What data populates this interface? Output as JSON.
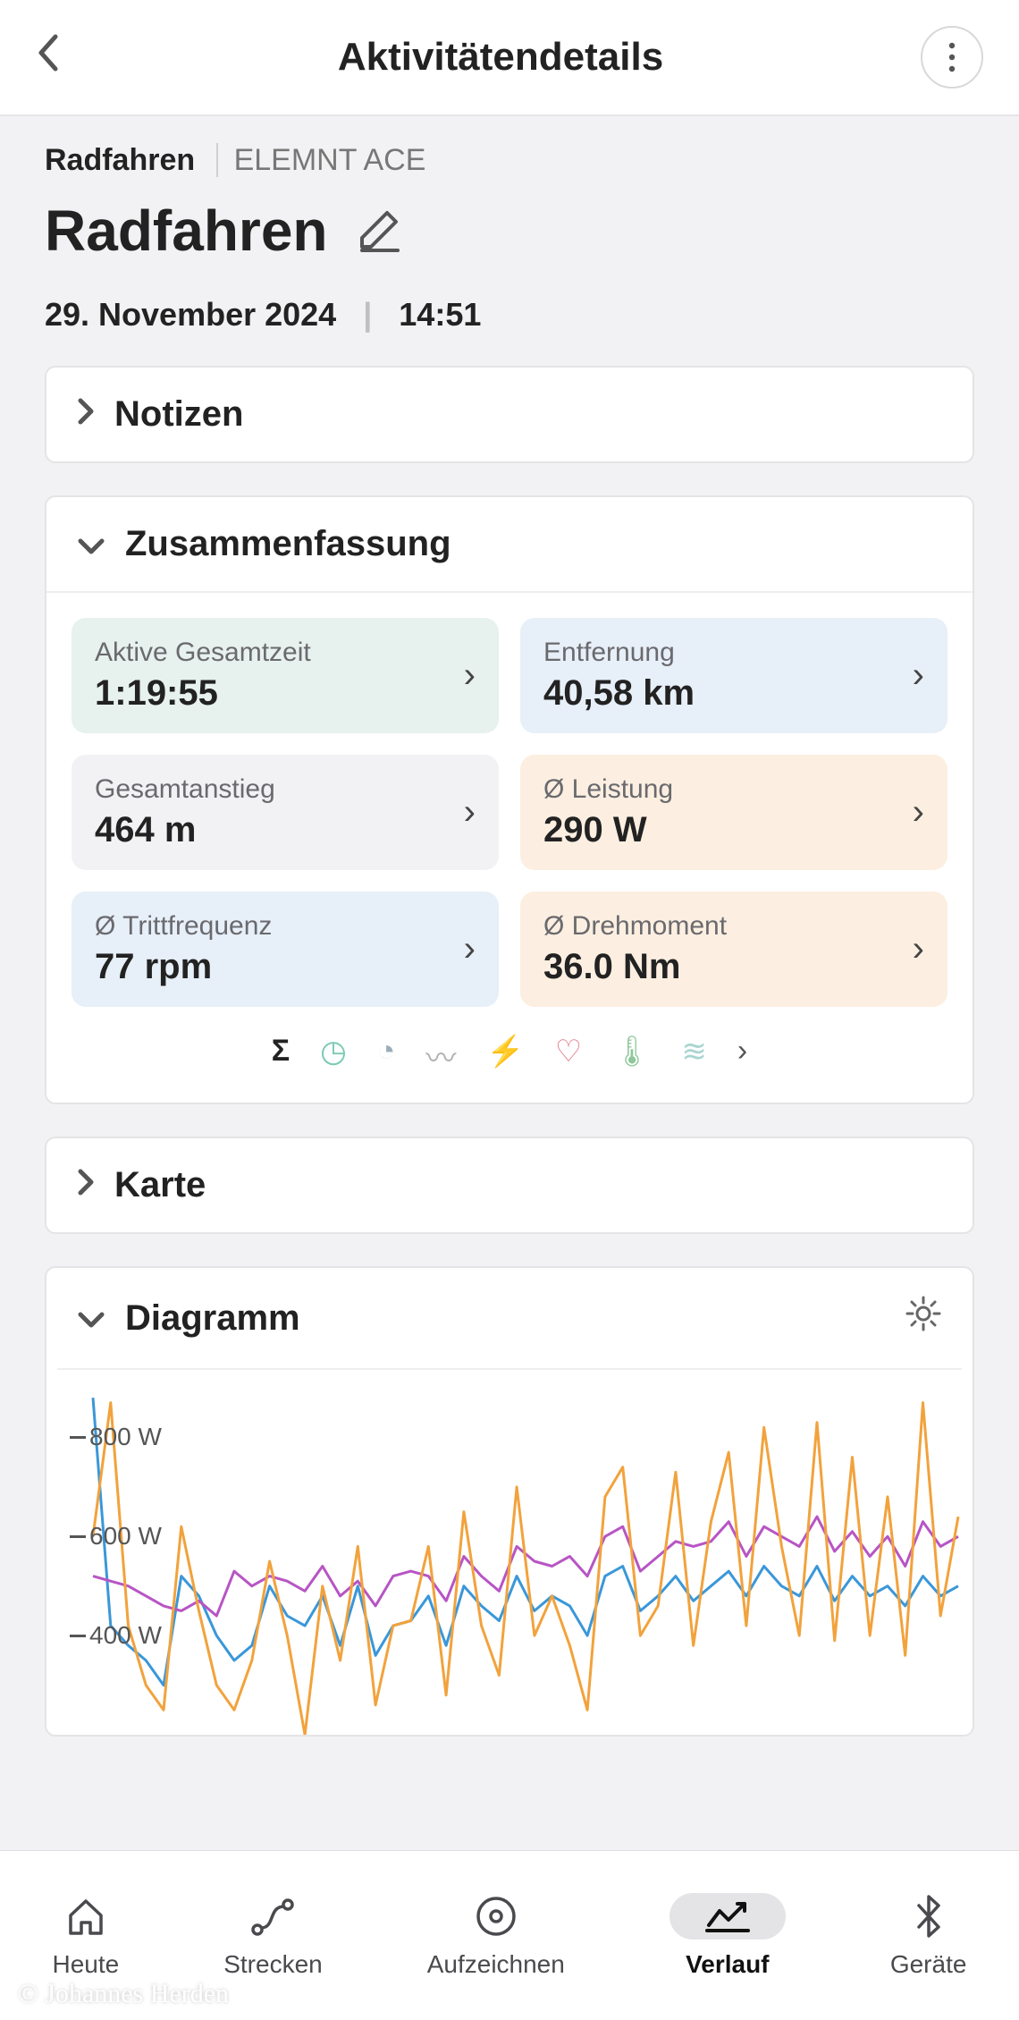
{
  "header": {
    "title": "Aktivitätendetails"
  },
  "breadcrumb": {
    "category": "Radfahren",
    "device": "ELEMNT ACE"
  },
  "activity": {
    "name": "Radfahren",
    "date": "29. November 2024",
    "time": "14:51"
  },
  "sections": {
    "notes": "Notizen",
    "summary": "Zusammenfassung",
    "map": "Karte",
    "chart": "Diagramm"
  },
  "tiles": {
    "active_time": {
      "label": "Aktive Gesamtzeit",
      "value": "1:19:55"
    },
    "distance": {
      "label": "Entfernung",
      "value": "40,58 km"
    },
    "total_climb": {
      "label": "Gesamtanstieg",
      "value": "464 m"
    },
    "avg_power": {
      "label": "Ø Leistung",
      "value": "290 W"
    },
    "avg_cadence": {
      "label": "Ø Trittfrequenz",
      "value": "77 rpm"
    },
    "avg_torque": {
      "label": "Ø Drehmoment",
      "value": "36.0 Nm"
    }
  },
  "nav": {
    "today": "Heute",
    "routes": "Strecken",
    "record": "Aufzeichnen",
    "history": "Verlauf",
    "devices": "Geräte"
  },
  "chart_data": {
    "type": "line",
    "ylabel": "W",
    "y_ticks": [
      400,
      600,
      800
    ],
    "ylim": [
      200,
      900
    ],
    "series": [
      {
        "name": "blue",
        "color": "#3a97d9",
        "values": [
          880,
          420,
          380,
          350,
          300,
          520,
          480,
          400,
          350,
          380,
          500,
          440,
          420,
          480,
          380,
          500,
          360,
          420,
          430,
          480,
          380,
          500,
          460,
          430,
          520,
          450,
          480,
          460,
          400,
          520,
          540,
          450,
          480,
          520,
          470,
          500,
          530,
          480,
          540,
          500,
          480,
          540,
          470,
          520,
          480,
          500,
          460,
          520,
          480,
          500
        ]
      },
      {
        "name": "magenta",
        "color": "#b755c4",
        "values": [
          520,
          510,
          500,
          480,
          460,
          450,
          470,
          440,
          530,
          500,
          520,
          510,
          490,
          540,
          480,
          510,
          460,
          520,
          530,
          520,
          470,
          560,
          520,
          490,
          580,
          550,
          540,
          560,
          520,
          600,
          620,
          530,
          560,
          590,
          580,
          590,
          630,
          560,
          620,
          600,
          580,
          640,
          570,
          610,
          560,
          600,
          540,
          630,
          580,
          600
        ]
      },
      {
        "name": "orange",
        "color": "#f2a23c",
        "values": [
          600,
          870,
          420,
          300,
          250,
          620,
          450,
          300,
          250,
          350,
          550,
          400,
          200,
          500,
          350,
          580,
          260,
          420,
          430,
          580,
          280,
          650,
          420,
          320,
          700,
          400,
          480,
          380,
          250,
          680,
          740,
          400,
          460,
          730,
          380,
          630,
          770,
          420,
          820,
          580,
          400,
          830,
          390,
          760,
          400,
          680,
          360,
          870,
          440,
          640
        ]
      }
    ]
  },
  "watermark": "© Johannes Herden"
}
